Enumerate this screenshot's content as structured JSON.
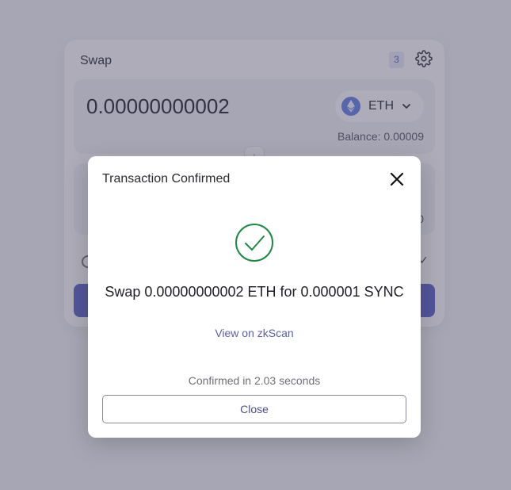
{
  "swap_card": {
    "title": "Swap",
    "queue_badge": "3",
    "from": {
      "amount": "0.00000000002",
      "token": "ETH",
      "balance": "Balance: 0.00009"
    },
    "to": {
      "balance": "0"
    },
    "icons": {
      "settings": "gear-icon",
      "flip": "arrow-down-icon",
      "token": "ethereum-logo-icon",
      "dropdown": "chevron-down-icon"
    }
  },
  "modal": {
    "title": "Transaction Confirmed",
    "close_icon": "close-icon",
    "status_icon": "check-circle-icon",
    "summary": "Swap 0.00000000002 ETH for 0.000001 SYNC",
    "link_text": "View on zkScan",
    "duration": "Confirmed in 2.03 seconds",
    "close_label": "Close"
  },
  "colors": {
    "accent": "#5b5fc7",
    "success": "#1c8a42",
    "eth": "#627eea",
    "overlay": "#4a4862"
  }
}
